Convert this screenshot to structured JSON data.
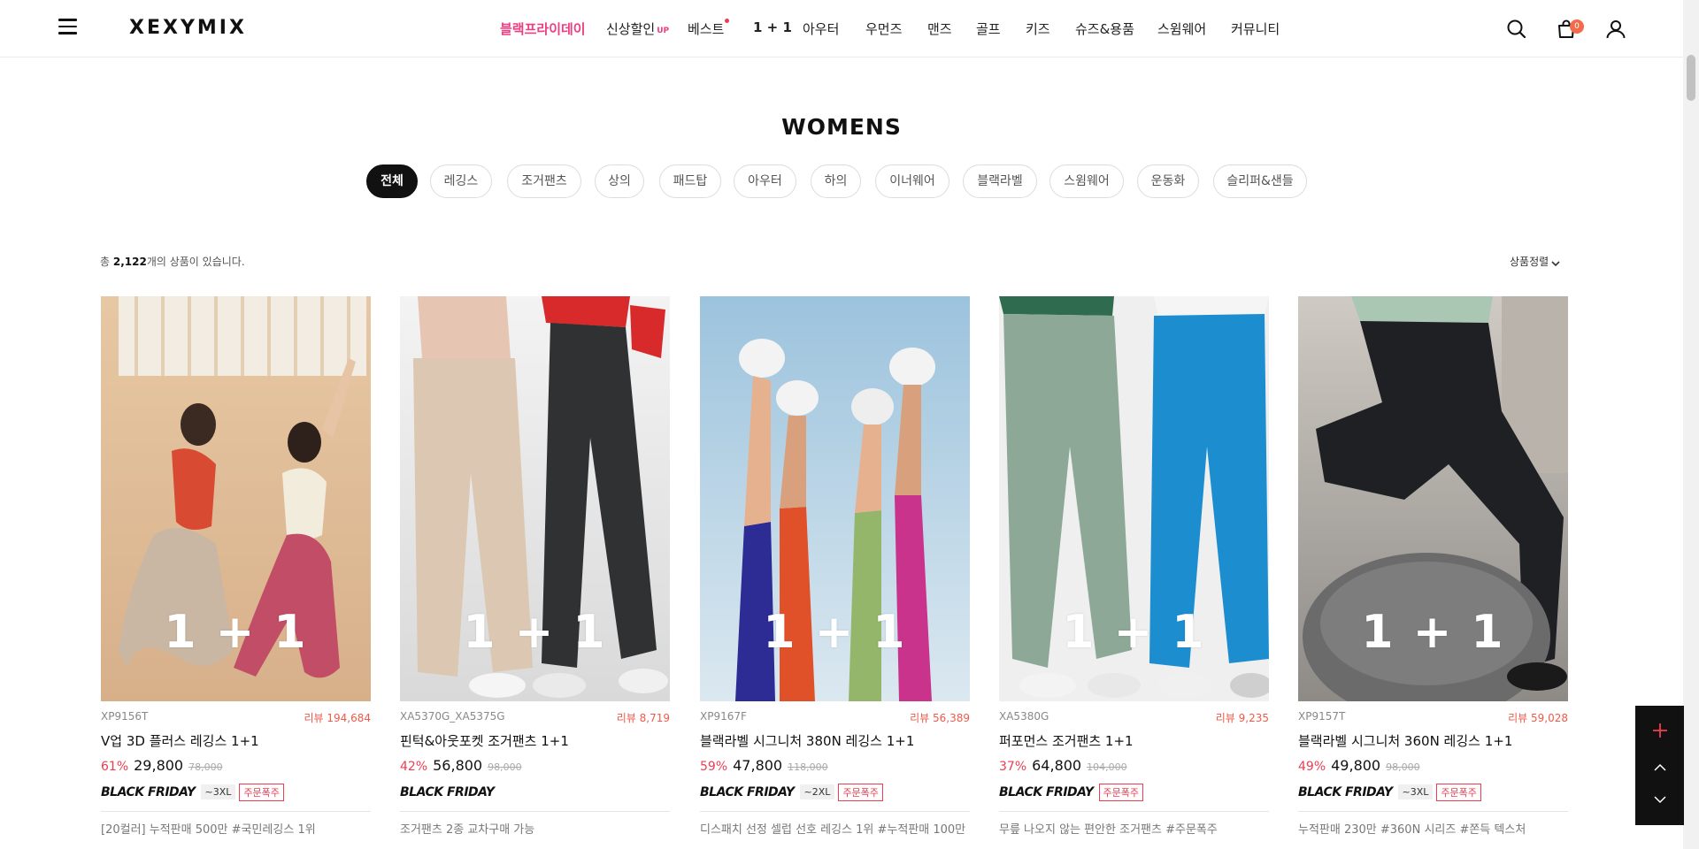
{
  "header": {
    "logo": "XEXYMIX",
    "nav": [
      {
        "label": "블랙프라이데이",
        "style": "pink"
      },
      {
        "label": "신상할인",
        "suffix": "UP"
      },
      {
        "label": "베스트",
        "dot": true
      },
      {
        "label": "1 + 1",
        "style": "bold"
      },
      {
        "label": "아우터"
      },
      {
        "label": "우먼즈"
      },
      {
        "label": "맨즈"
      },
      {
        "label": "골프"
      },
      {
        "label": "키즈"
      },
      {
        "label": "슈즈&용품"
      },
      {
        "label": "스윔웨어"
      },
      {
        "label": "커뮤니티"
      }
    ],
    "icons": [
      "menu-icon",
      "search-icon",
      "shopping-bag-icon",
      "user-icon"
    ],
    "cart_count": "0"
  },
  "main": {
    "title": "WOMENS",
    "categories": [
      "전체",
      "레깅스",
      "조거팬츠",
      "상의",
      "패드탑",
      "아우터",
      "하의",
      "이너웨어",
      "블랙라벨",
      "스윔웨어",
      "운동화",
      "슬리퍼&샌들"
    ],
    "active_category": "전체",
    "count_prefix": "총 ",
    "count_value": "2,122",
    "count_suffix": "개의 상품이 있습니다.",
    "sort_label": "상품정렬"
  },
  "products": [
    {
      "code": "XP9156T",
      "review": "리뷰 194,684",
      "name": "V업 3D 플러스 레깅스 1+1",
      "discount": "61%",
      "price": "29,800",
      "original": "78,000",
      "badge": "BLACK FRIDAY",
      "size": "~3XL",
      "hot": "주문폭주",
      "desc": "[20컬러] 누적판매 500만 #국민레깅스 1위",
      "overlay": "1 + 1"
    },
    {
      "code": "XA5370G_XA5375G",
      "review": "리뷰 8,719",
      "name": "핀턱&아웃포켓 조거팬츠 1+1",
      "discount": "42%",
      "price": "56,800",
      "original": "98,000",
      "badge": "BLACK FRIDAY",
      "size": "",
      "hot": "",
      "desc": "조거팬츠 2종 교차구매 가능",
      "overlay": "1 + 1"
    },
    {
      "code": "XP9167F",
      "review": "리뷰 56,389",
      "name": "블랙라벨 시그니처 380N 레깅스 1+1",
      "discount": "59%",
      "price": "47,800",
      "original": "118,000",
      "badge": "BLACK FRIDAY",
      "size": "~2XL",
      "hot": "주문폭주",
      "desc": "디스패치 선정 셀럽 선호 레깅스 1위 #누적판매 100만",
      "overlay": "1 + 1"
    },
    {
      "code": "XA5380G",
      "review": "리뷰 9,235",
      "name": "퍼포먼스 조거팬츠 1+1",
      "discount": "37%",
      "price": "64,800",
      "original": "104,000",
      "badge": "BLACK FRIDAY",
      "size": "",
      "hot": "주문폭주",
      "desc": "무릎 나오지 않는 편안한 조거팬츠 #주문폭주",
      "overlay": "1 + 1"
    },
    {
      "code": "XP9157T",
      "review": "리뷰 59,028",
      "name": "블랙라벨 시그니처 360N 레깅스 1+1",
      "discount": "49%",
      "price": "49,800",
      "original": "98,000",
      "badge": "BLACK FRIDAY",
      "size": "~3XL",
      "hot": "주문폭주",
      "desc": "누적판매 230만 #360N 시리즈 #쫀득 텍스처",
      "overlay": "1 + 1"
    }
  ],
  "floating": {
    "icons": [
      "plus-icon",
      "chevron-up-icon",
      "chevron-down-icon"
    ]
  },
  "colors": {
    "accent_pink": "#ee3d82",
    "sale_red": "#ee3d50",
    "cart_badge": "#f26b4a"
  }
}
